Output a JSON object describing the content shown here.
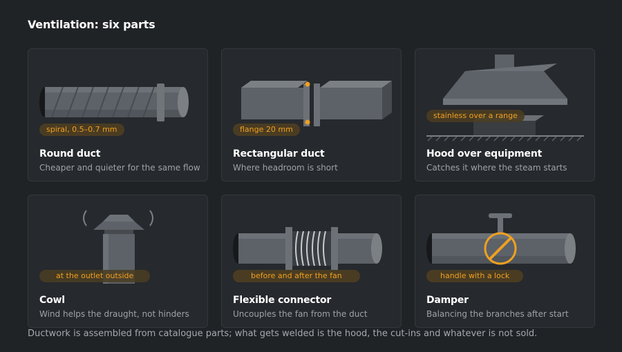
{
  "page": {
    "title": "Ventilation: six parts",
    "footnote": "Ductwork is assembled from catalogue parts; what gets welded is the hood, the cut-ins and whatever is not sold."
  },
  "colors": {
    "background": "#202326",
    "card": "#26292d",
    "metal": "#5d6268",
    "accent": "#f0a021",
    "tag_bg": "#4a3c22"
  },
  "cards": [
    {
      "title": "Round duct",
      "description": "Cheaper and quieter for the same flow",
      "tag": "spiral, 0.5–0.7 mm",
      "icon": "round-duct-icon"
    },
    {
      "title": "Rectangular duct",
      "description": "Where headroom is short",
      "tag": "flange 20 mm",
      "icon": "rectangular-duct-icon"
    },
    {
      "title": "Hood over equipment",
      "description": "Catches it where the steam starts",
      "tag": "stainless over a range",
      "icon": "hood-icon"
    },
    {
      "title": "Cowl",
      "description": "Wind helps the draught, not hinders",
      "tag": "at the outlet outside",
      "icon": "cowl-icon"
    },
    {
      "title": "Flexible connector",
      "description": "Uncouples the fan from the duct",
      "tag": "before and after the fan",
      "icon": "flexible-connector-icon"
    },
    {
      "title": "Damper",
      "description": "Balancing the branches after start",
      "tag": "handle with a lock",
      "icon": "damper-icon"
    }
  ]
}
